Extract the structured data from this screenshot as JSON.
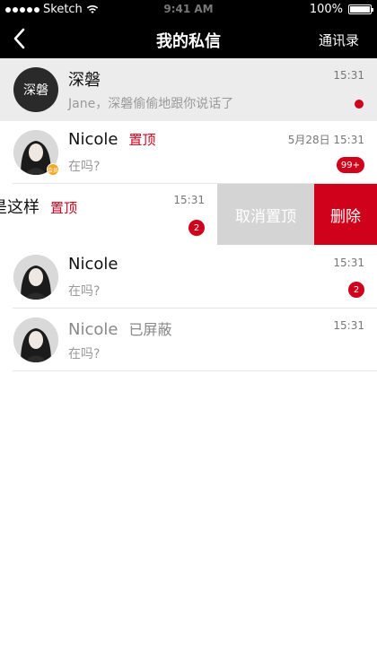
{
  "status_bar": {
    "carrier": "Sketch",
    "time": "9:41 AM",
    "battery": "100%"
  },
  "nav": {
    "title": "我的私信",
    "contacts": "通讯录"
  },
  "conversations": [
    {
      "name": "深磐",
      "avatar_text": "深磐",
      "message": "Jane，深磐偷偷地跟你说话了",
      "time": "15:31",
      "unread": "dot"
    },
    {
      "name": "Nicole",
      "tag": "置顶",
      "vip_label": "会员",
      "message": "在吗?",
      "time": "5月28日 15:31",
      "badge": "99+"
    },
    {
      "name": "是这样",
      "tag": "置顶",
      "time": "15:31",
      "badge": "2",
      "actions": {
        "unpin": "取消置顶",
        "delete": "删除"
      }
    },
    {
      "name": "Nicole",
      "message": "在吗?",
      "time": "15:31",
      "badge": "2"
    },
    {
      "name": "Nicole",
      "tag": "已屏蔽",
      "message": "在吗?",
      "time": "15:31"
    }
  ],
  "colors": {
    "accent": "#d0021b",
    "nav_bg": "#000000",
    "highlight_bg": "#ececec",
    "vip": "#f5a623"
  }
}
